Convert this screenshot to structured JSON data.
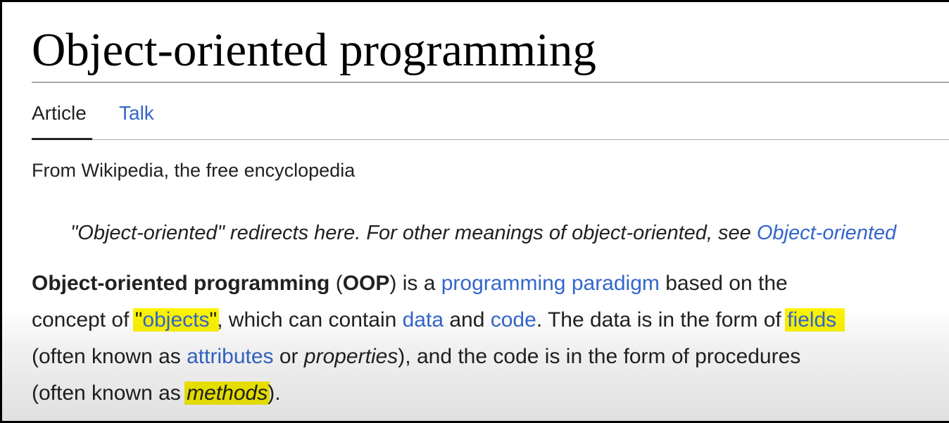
{
  "page": {
    "title": "Object-oriented programming"
  },
  "tabs": {
    "article": "Article",
    "talk": "Talk"
  },
  "tagline": "From Wikipedia, the free encyclopedia",
  "hatnote": {
    "text": "\"Object-oriented\" redirects here. For other meanings of object-oriented, see ",
    "link": "Object-oriented"
  },
  "paragraph": {
    "bold_term": "Object-oriented programming",
    "open_paren": " (",
    "bold_abbr": "OOP",
    "is_a": ") is a ",
    "link_paradigm": "programming paradigm",
    "based_on": " based on the",
    "concept_of": "concept of ",
    "quote_open": "\"",
    "link_objects": "objects",
    "quote_close": "\"",
    "which_can": ", which can contain ",
    "link_data": "data",
    "and": " and ",
    "link_code": "code",
    "data_form": ". The data is in the form of ",
    "link_fields": "fields",
    "often_known_1": "(often known as ",
    "link_attributes": "attributes",
    "or": " or ",
    "properties": "properties",
    "code_form": "), and the code is in the form of procedures",
    "often_known_2": "(often known as ",
    "methods": "methods",
    "end": ")."
  },
  "colors": {
    "link": "#3366cc",
    "text": "#202122",
    "highlight": "#fbf300",
    "rule": "#a2a9b1"
  }
}
